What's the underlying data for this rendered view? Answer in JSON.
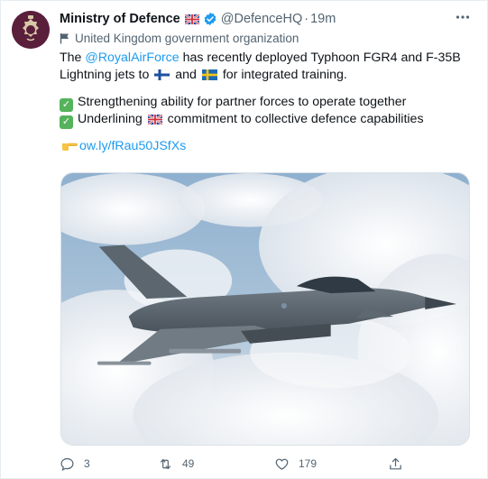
{
  "tweet": {
    "author_name": "Ministry of Defence",
    "handle": "@DefenceHQ",
    "separator": "·",
    "time": "19m",
    "org_label": "United Kingdom government organization",
    "text": {
      "line1_pre": "The ",
      "line1_mention": "@RoyalAirForce",
      "line1_post": " has recently deployed Typhoon FGR4 and F-35B",
      "line2_pre": "Lightning jets to ",
      "line2_mid": " and ",
      "line2_post": " for integrated training.",
      "bullet1": "Strengthening ability for partner forces to operate together",
      "bullet2_pre": "Underlining ",
      "bullet2_post": " commitment to collective defence capabilities",
      "link": "ow.ly/fRau50JSfXs"
    },
    "image_alt": "Eurofighter Typhoon jet flying above clouds"
  },
  "actions": {
    "reply_count": "3",
    "retweet_count": "49",
    "like_count": "179"
  },
  "icons": {
    "more": "more-icon",
    "verified": "verified-badge-icon",
    "org": "government-flag-icon",
    "reply": "reply-icon",
    "retweet": "retweet-icon",
    "like": "heart-icon",
    "share": "share-icon"
  },
  "colors": {
    "accent": "#1d9bf0",
    "text": "#0f1419",
    "muted": "#536471",
    "avatar_bg": "#5a1f3b",
    "check_emoji": "#55b35b"
  }
}
